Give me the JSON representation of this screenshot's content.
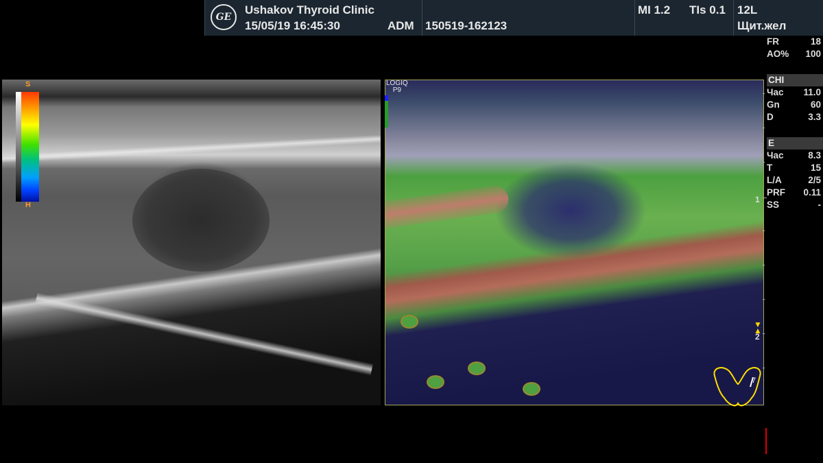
{
  "header": {
    "clinic": "Ushakov Thyroid Clinic",
    "datetime": "15/05/19 16:45:30",
    "operator": "ADM",
    "exam_id": "150519-162123",
    "mi": "MI 1.2",
    "tis": "TIs 0.1",
    "probe": "12L",
    "preset": "Щит.жел",
    "logo_text": "GE"
  },
  "params_top": [
    {
      "label": "FR",
      "value": "18"
    },
    {
      "label": "AO%",
      "value": "100"
    }
  ],
  "chi": {
    "title": "CHI",
    "rows": [
      {
        "label": "Час",
        "value": "11.0"
      },
      {
        "label": "Gn",
        "value": "60"
      },
      {
        "label": "D",
        "value": "3.3"
      }
    ]
  },
  "elasto": {
    "title": "E",
    "rows": [
      {
        "label": "Час",
        "value": "8.3"
      },
      {
        "label": "T",
        "value": "15"
      },
      {
        "label": "L/A",
        "value": "2/5"
      },
      {
        "label": "PRF",
        "value": "0.11"
      },
      {
        "label": "SS",
        "value": "-"
      }
    ]
  },
  "colorbar": {
    "top_label": "S",
    "bottom_label": "H"
  },
  "elasto_image": {
    "logo_line1": "LOGIQ",
    "logo_line2": "P9"
  },
  "ruler": {
    "label1": "1",
    "label2": "2"
  },
  "bodymark": {
    "label": "7"
  },
  "colors": {
    "header_bg": "#1b2630",
    "param_head_bg": "#3a3a3a",
    "bodymark": "#ffe000"
  }
}
